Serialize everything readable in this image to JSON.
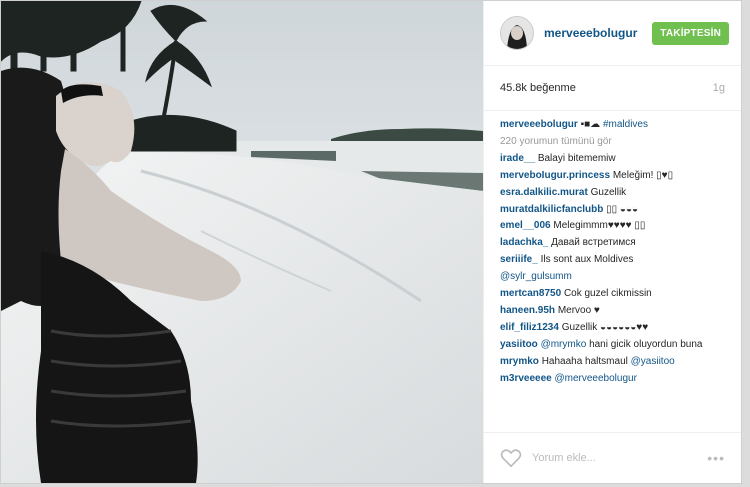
{
  "post": {
    "username": "merveeebolugur",
    "follow_label": "TAKİPTESİN",
    "likes": "45.8k beğenme",
    "time": "1g",
    "caption": {
      "user": "merveeebolugur",
      "emojis": "▪■☁",
      "hashtag": "#maldives"
    },
    "view_all": "220 yorumun tümünü gör",
    "comments": [
      {
        "user": "irade__",
        "text": "Balayi bitememiw"
      },
      {
        "user": "merveboIugur.princess",
        "text": "Meleğim! ▯♥▯"
      },
      {
        "user": "esra.dalkilic.murat",
        "text": "Guzellik"
      },
      {
        "user": "muratdalkilicfanclubb",
        "text": "▯▯ ◒◒◒"
      },
      {
        "user": "emel__006",
        "text": "Melegimmm♥♥♥♥ ▯▯"
      },
      {
        "user": "ladachka_",
        "text": "Давай встретимся"
      },
      {
        "user": "seriiife_",
        "text": "Ils sont aux Moldives",
        "tag": "@sylr_gulsumm"
      },
      {
        "user": "mertcan8750",
        "text": "Cok guzel cikmissin"
      },
      {
        "user": "haneen.95h",
        "text": "Mervoo ♥"
      },
      {
        "user": "elif_filiz1234",
        "text": "Guzellik ◒◒◒◒◒◒♥♥"
      },
      {
        "user": "yasiitoo",
        "tag": "@mrymko",
        "text": "hani gicik oluyordun buna"
      },
      {
        "user": "mrymko",
        "text": "Hahaaha haltsmaul",
        "tag": "@yasiitoo"
      },
      {
        "user": "m3rveeeee",
        "tag": "@merveeebolugur",
        "text": ""
      }
    ],
    "add_comment_placeholder": "Yorum ekle...",
    "more_label": "•••"
  },
  "icons": {
    "heart": "heart-icon",
    "more": "more-options-icon"
  }
}
